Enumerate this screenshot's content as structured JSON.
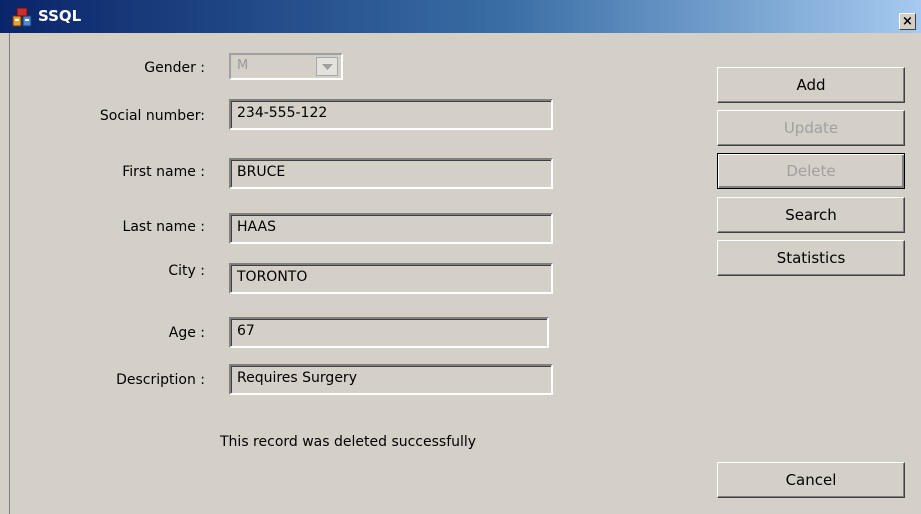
{
  "window": {
    "title": "SSQL",
    "close_glyph": "×"
  },
  "form": {
    "gender": {
      "label": "Gender :",
      "value": "M"
    },
    "social_number": {
      "label": "Social number:",
      "value": "234-555-122"
    },
    "first_name": {
      "label": "First name :",
      "value": "BRUCE"
    },
    "last_name": {
      "label": "Last name :",
      "value": "HAAS"
    },
    "city": {
      "label": "City :",
      "value": "TORONTO"
    },
    "age": {
      "label": "Age :",
      "value": "67"
    },
    "description": {
      "label": "Description :",
      "value": "Requires Surgery"
    }
  },
  "buttons": {
    "add": "Add",
    "update": "Update",
    "delete": "Delete",
    "search": "Search",
    "statistics": "Statistics",
    "cancel": "Cancel"
  },
  "status_message": "This record was deleted successfully",
  "icons": {
    "app": "database-app-icon",
    "close": "close-icon",
    "dropdown": "chevron-down-icon"
  },
  "colors": {
    "titlebar_start": "#0a246a",
    "titlebar_end": "#a6caf0",
    "face": "#d4d0c8"
  }
}
